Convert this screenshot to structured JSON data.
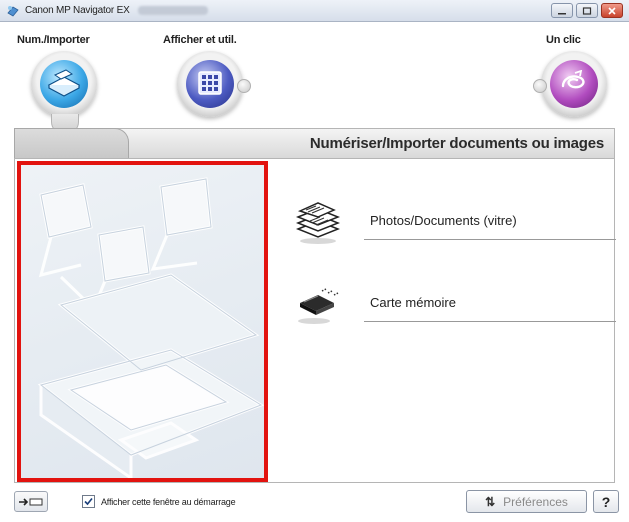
{
  "window": {
    "title": "Canon MP Navigator EX",
    "controls": [
      "minimize",
      "restore",
      "close"
    ]
  },
  "modes": [
    {
      "label": "Num./Importer",
      "icon": "scanner-icon",
      "selected": true
    },
    {
      "label": "Afficher et util.",
      "icon": "grid-view-icon",
      "selected": false
    },
    {
      "label": "Un clic",
      "icon": "one-click-icon",
      "selected": false
    }
  ],
  "header": {
    "title": "Numériser/Importer documents ou images"
  },
  "menu": [
    {
      "label": "Photos/Documents (vitre)",
      "icon": "documents-stack-icon"
    },
    {
      "label": "Carte mémoire",
      "icon": "memory-card-icon"
    }
  ],
  "footer": {
    "show_at_startup_label": "Afficher cette fenêtre au démarrage",
    "show_at_startup_checked": true,
    "preferences_label": "Préférences",
    "help_label": "?"
  },
  "colors": {
    "highlight_border": "#e2130f",
    "scan_mode": "#3ba7e6",
    "view_mode": "#4d5bc2",
    "oneclick_mode": "#b14cbf"
  }
}
